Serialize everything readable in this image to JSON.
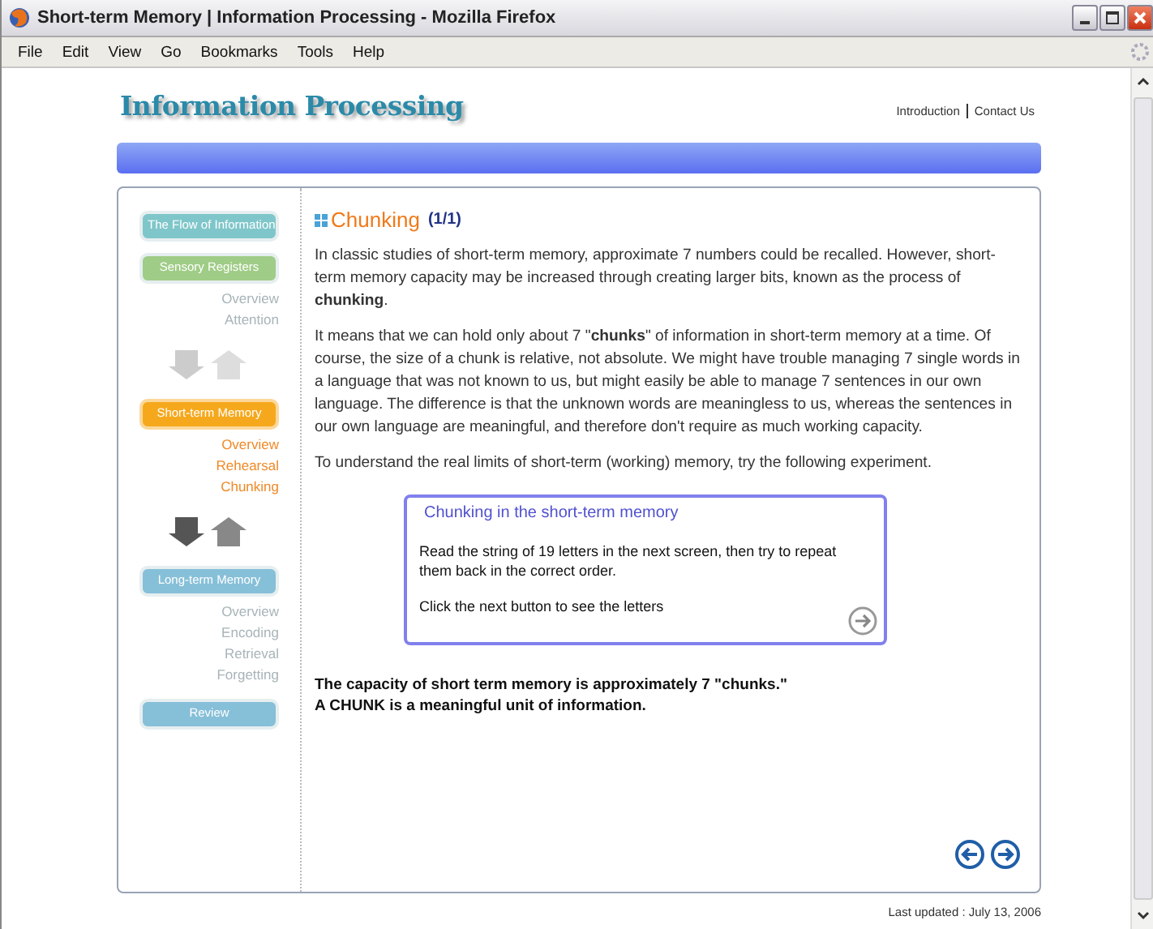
{
  "window": {
    "title": "Short-term Memory | Information Processing - Mozilla Firefox"
  },
  "menu": [
    "File",
    "Edit",
    "View",
    "Go",
    "Bookmarks",
    "Tools",
    "Help"
  ],
  "site": {
    "title": "Information Processing",
    "links": [
      "Introduction",
      "Contact Us"
    ]
  },
  "sidebar": [
    {
      "kind": "button",
      "label": "The Flow of Information",
      "selected": false,
      "color": "#7fc6ca"
    },
    {
      "kind": "button",
      "label": "Sensory Registers",
      "selected": false,
      "color": "#9fcc86"
    },
    {
      "kind": "links",
      "active": false,
      "items": [
        "Overview",
        "Attention"
      ]
    },
    {
      "kind": "arrows",
      "active": false
    },
    {
      "kind": "button",
      "label": "Short-term Memory",
      "selected": true,
      "color": "#f6a81c"
    },
    {
      "kind": "links",
      "active": true,
      "items": [
        "Overview",
        "Rehearsal",
        "Chunking"
      ]
    },
    {
      "kind": "arrows",
      "active": true
    },
    {
      "kind": "button",
      "label": "Long-term Memory",
      "selected": false,
      "color": "#86bfd8"
    },
    {
      "kind": "links",
      "active": false,
      "items": [
        "Overview",
        "Encoding",
        "Retrieval",
        "Forgetting"
      ]
    },
    {
      "kind": "button",
      "label": "Review",
      "selected": false,
      "color": "#86bfd8"
    }
  ],
  "content": {
    "heading": "Chunking",
    "page": "(1/1)",
    "paragraphs": [
      "In classic studies of short-term memory, approximate 7 numbers could be recalled. However, short-term memory capacity may be increased through creating larger bits, known as the process of **chunking**.",
      "It means that we can hold only about 7 \"**chunks**\" of information in short-term memory at a time. Of course, the size of a chunk is relative, not absolute. We might have trouble managing 7 single words in a language that was not known to us, but might easily be able to manage 7 sentences in our own language. The difference is that the unknown words are meaningless to us, whereas the sentences in our own language are meaningful, and therefore don't require as much working capacity.",
      "To understand the real limits of short-term (working) memory, try the following experiment."
    ],
    "activity": {
      "title": "Chunking in the short-term memory",
      "texts": [
        "Read the string of 19 letters in the next screen,  then  try to repeat them back in the correct order.",
        "Click the next button to see the letters"
      ]
    },
    "summary": [
      "The capacity of short term memory is approximately 7 \"chunks.\"",
      "A CHUNK is a meaningful unit of information."
    ]
  },
  "footer": "Last updated : July 13, 2006"
}
